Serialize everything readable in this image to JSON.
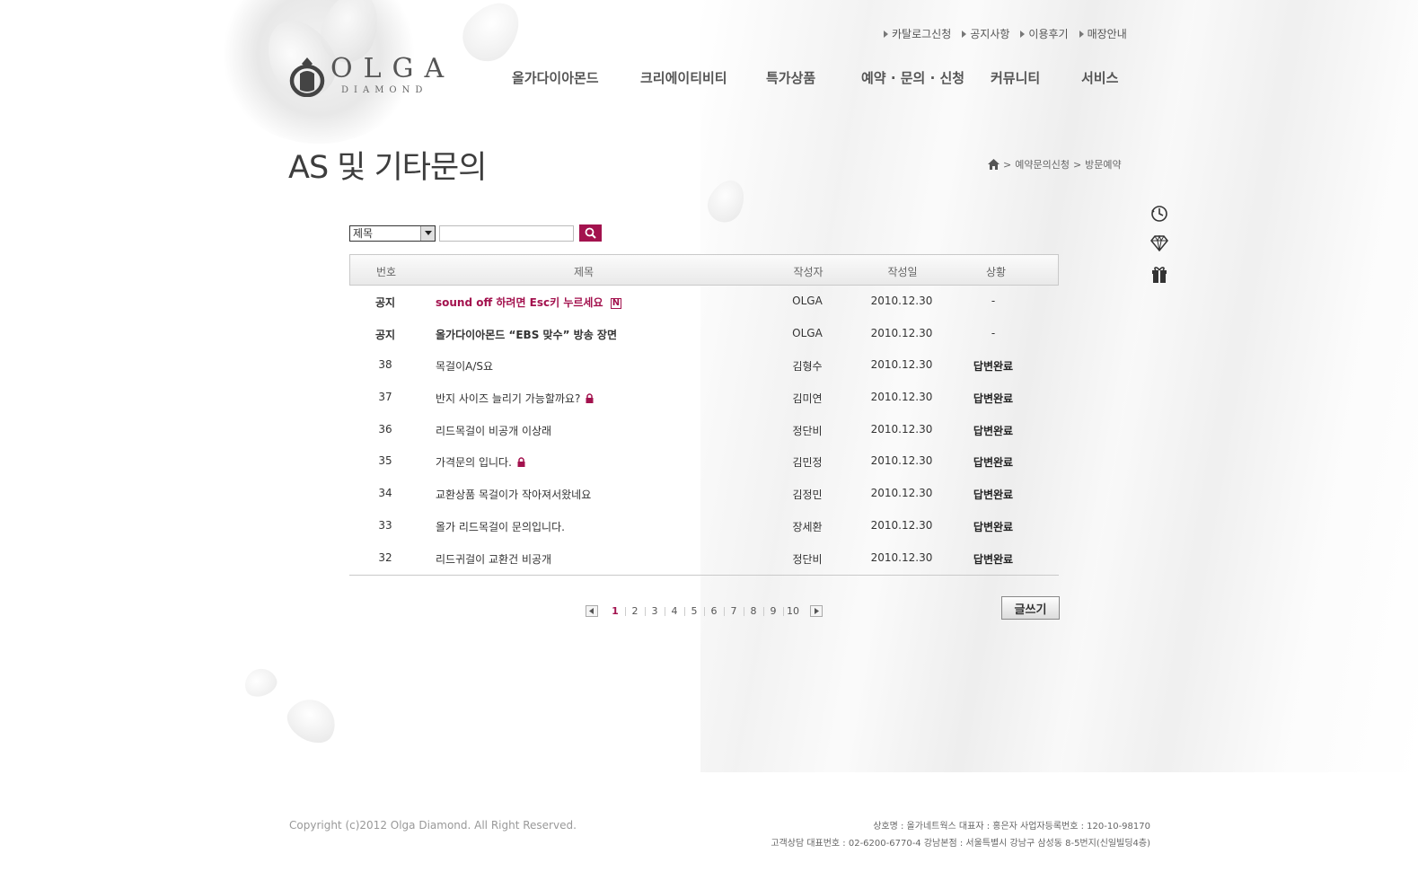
{
  "util_links": [
    "카탈로그신청",
    "공지사항",
    "이용후기",
    "매장안내"
  ],
  "logo": {
    "name": "OLGA",
    "sub": "DIAMOND"
  },
  "gnb": [
    "올가다이아몬드",
    "크리에이티비티",
    "특가상품",
    "예약 · 문의 · 신청",
    "커뮤니티",
    "서비스"
  ],
  "page_title": "AS 및 기타문의",
  "breadcrumb": [
    "예약문의신청",
    "방문예약"
  ],
  "search": {
    "select_value": "제목",
    "input_value": ""
  },
  "board": {
    "headers": {
      "num": "번호",
      "title": "제목",
      "writer": "작성자",
      "date": "작성일",
      "status": "상황"
    },
    "rows": [
      {
        "num": "공지",
        "title": "sound off 하려면 Esc키 누르세요",
        "badge": "N",
        "writer": "OLGA",
        "date": "2010.12.30",
        "status": "-"
      },
      {
        "num": "공지",
        "title": "올가다이아몬드 “EBS 맞수” 방송 장면",
        "writer": "OLGA",
        "date": "2010.12.30",
        "status": "-"
      },
      {
        "num": "38",
        "title": "목걸이A/S요",
        "writer": "김형수",
        "date": "2010.12.30",
        "status": "답변완료"
      },
      {
        "num": "37",
        "title": "반지 사이즈 늘리기 가능할까요?",
        "writer": "김미연",
        "date": "2010.12.30",
        "status": "답변완료"
      },
      {
        "num": "36",
        "title": "리드목걸이  비공개 이상래",
        "writer": "정단비",
        "date": "2010.12.30",
        "status": "답변완료"
      },
      {
        "num": "35",
        "title": "가격문의 입니다.",
        "writer": "김민정",
        "date": "2010.12.30",
        "status": "답변완료"
      },
      {
        "num": "34",
        "title": "교환상품 목걸이가 작아져서왔네요",
        "writer": "김정민",
        "date": "2010.12.30",
        "status": "답변완료"
      },
      {
        "num": "33",
        "title": "올가 리드목걸이 문의입니다.",
        "writer": "장세환",
        "date": "2010.12.30",
        "status": "답변완료"
      },
      {
        "num": "32",
        "title": "리드귀걸이 교환건  비공개",
        "writer": "정단비",
        "date": "2010.12.30",
        "status": "답변완료"
      }
    ]
  },
  "pagination": {
    "current": "1",
    "pages": [
      "1",
      "2",
      "3",
      "4",
      "5",
      "6",
      "7",
      "8",
      "9",
      "10"
    ]
  },
  "write_button": "글쓰기",
  "footer": {
    "copyright": "Copyright (c)2012 Olga Diamond. All Right Reserved.",
    "line1": "상호명 : 올가네트웍스    대표자 : 홍은자    사업자등록번호 : 120-10-98170",
    "line2": "고객상담 대표번호 : 02-6200-6770-4    강남본점 : 서울특별시 강남구 삼성동 8-5번지(신일빌딩4층)"
  },
  "icons": {
    "util_bullet": "triangle-right-icon",
    "home": "home-icon",
    "search": "search-icon",
    "lock": "lock-icon",
    "quick": [
      "clock-icon",
      "diamond-icon",
      "gift-icon"
    ]
  },
  "colors": {
    "accent": "#a3124e",
    "text": "#333333",
    "border": "#c9c9c9"
  }
}
